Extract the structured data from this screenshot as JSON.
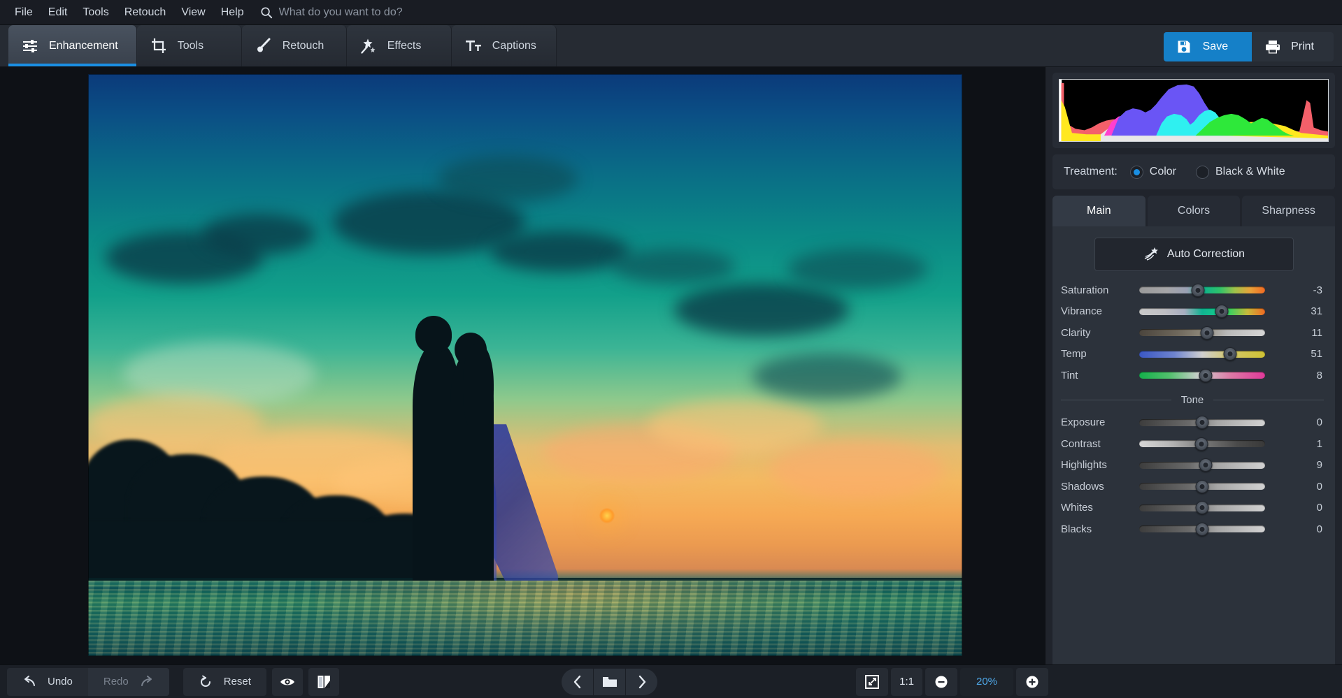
{
  "app": {
    "accent": "#1a8fe3",
    "panel_bg": "#20242c",
    "canvas_bg": "#0e1116"
  },
  "menubar": {
    "items": [
      {
        "label": "File"
      },
      {
        "label": "Edit"
      },
      {
        "label": "Tools"
      },
      {
        "label": "Retouch"
      },
      {
        "label": "View"
      },
      {
        "label": "Help"
      }
    ],
    "search": {
      "icon": "search-icon",
      "placeholder": "What do you want to do?",
      "value": ""
    }
  },
  "tabs": [
    {
      "label": "Enhancement",
      "icon": "sliders-icon",
      "active": true
    },
    {
      "label": "Tools",
      "icon": "crop-icon",
      "active": false
    },
    {
      "label": "Retouch",
      "icon": "brush-icon",
      "active": false
    },
    {
      "label": "Effects",
      "icon": "magic-wand-icon",
      "active": false
    },
    {
      "label": "Captions",
      "icon": "text-tool-icon",
      "active": false
    }
  ],
  "topright": {
    "save_label": "Save",
    "save_icon": "save-disk-icon",
    "print_label": "Print",
    "print_icon": "printer-icon"
  },
  "right_panel": {
    "histogram_title": "histogram",
    "treatment": {
      "label": "Treatment:",
      "options": [
        {
          "label": "Color",
          "selected": true
        },
        {
          "label": "Black & White",
          "selected": false
        }
      ]
    },
    "subtabs": [
      {
        "label": "Main",
        "active": true
      },
      {
        "label": "Colors",
        "active": false
      },
      {
        "label": "Sharpness",
        "active": false
      }
    ],
    "auto_correction": {
      "label": "Auto Correction",
      "icon": "magic-star-icon"
    },
    "color_sliders": [
      {
        "name": "Saturation",
        "value": "-3",
        "pos": 46.5,
        "ramp": "saturation"
      },
      {
        "name": "Vibrance",
        "value": "31",
        "pos": 65.5,
        "ramp": "vibrance"
      },
      {
        "name": "Clarity",
        "value": "11",
        "pos": 54.0,
        "ramp": "clarity"
      },
      {
        "name": "Temp",
        "value": "51",
        "pos": 72.0,
        "ramp": "temp"
      },
      {
        "name": "Tint",
        "value": "8",
        "pos": 53.0,
        "ramp": "tint"
      }
    ],
    "tone_divider_label": "Tone",
    "tone_sliders": [
      {
        "name": "Exposure",
        "value": "0",
        "pos": 50.0,
        "ramp": "neutral"
      },
      {
        "name": "Contrast",
        "value": "1",
        "pos": 49.5,
        "ramp": "contrast"
      },
      {
        "name": "Highlights",
        "value": "9",
        "pos": 53.0,
        "ramp": "neutral"
      },
      {
        "name": "Shadows",
        "value": "0",
        "pos": 50.0,
        "ramp": "neutral"
      },
      {
        "name": "Whites",
        "value": "0",
        "pos": 50.0,
        "ramp": "neutral"
      },
      {
        "name": "Blacks",
        "value": "0",
        "pos": 50.0,
        "ramp": "neutral"
      }
    ]
  },
  "bottombar": {
    "undo": {
      "label": "Undo",
      "icon": "undo-arrow-icon",
      "enabled": true
    },
    "redo": {
      "label": "Redo",
      "icon": "redo-arrow-icon",
      "enabled": false
    },
    "reset": {
      "label": "Reset",
      "icon": "reset-circle-icon"
    },
    "preview_icon": "eye-icon",
    "compare_icon": "split-compare-icon",
    "nav": {
      "prev_icon": "chevron-left-icon",
      "browse_icon": "folder-icon",
      "next_icon": "chevron-right-icon"
    },
    "zoom": {
      "fit_icon": "fit-to-screen-icon",
      "actual_label": "1:1",
      "minus_icon": "zoom-out-icon",
      "level": "20%",
      "plus_icon": "zoom-in-icon"
    }
  },
  "photo": {
    "description": "silhouette-of-kissing-couple-at-tropical-sunset-beach"
  }
}
